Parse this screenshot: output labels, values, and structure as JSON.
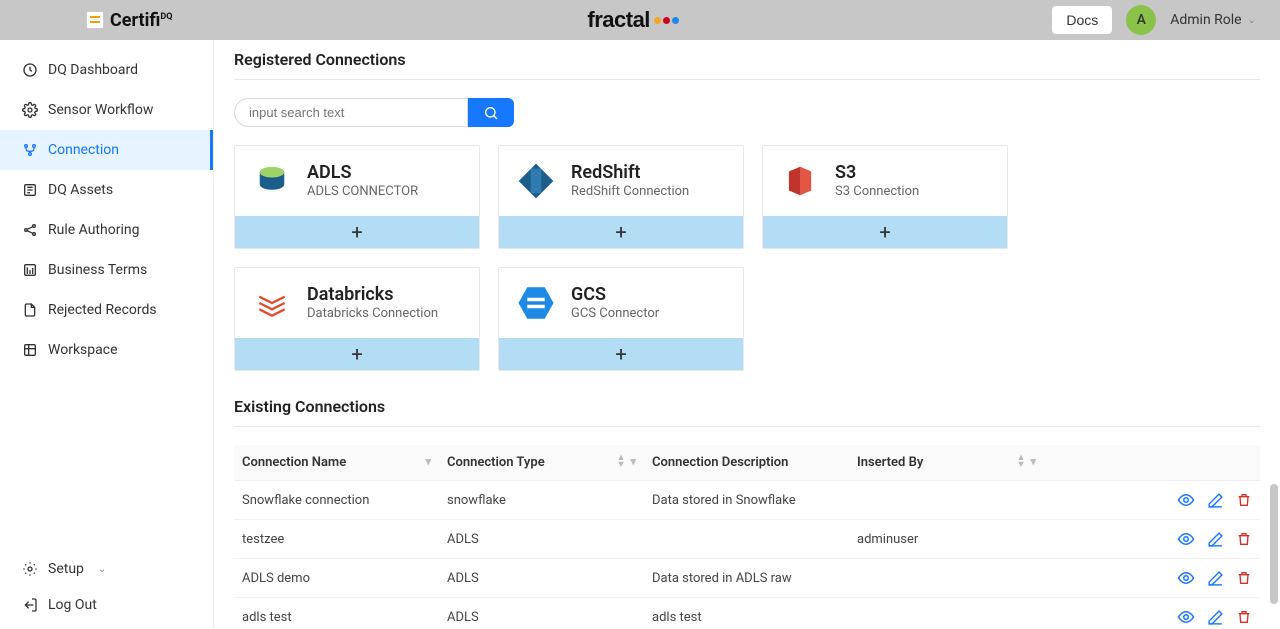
{
  "header": {
    "brand": "Certifi",
    "brand_suffix": "DQ",
    "center_brand": "fractal",
    "docs_label": "Docs",
    "avatar_initial": "A",
    "role_label": "Admin Role"
  },
  "sidebar": {
    "items": [
      {
        "label": "DQ Dashboard",
        "icon": "dashboard"
      },
      {
        "label": "Sensor Workflow",
        "icon": "gear"
      },
      {
        "label": "Connection",
        "icon": "branch",
        "active": true
      },
      {
        "label": "DQ Assets",
        "icon": "assets"
      },
      {
        "label": "Rule Authoring",
        "icon": "share"
      },
      {
        "label": "Business Terms",
        "icon": "terms"
      },
      {
        "label": "Rejected Records",
        "icon": "file"
      },
      {
        "label": "Workspace",
        "icon": "workspace"
      }
    ],
    "bottom": [
      {
        "label": "Setup",
        "icon": "gear",
        "caret": true
      },
      {
        "label": "Log Out",
        "icon": "logout"
      }
    ]
  },
  "connections": {
    "section_title": "Registered Connections",
    "search_placeholder": "input search text",
    "cards": [
      {
        "title": "ADLS",
        "subtitle": "ADLS CONNECTOR",
        "color1": "#7ac142",
        "color2": "#1b5e8c"
      },
      {
        "title": "RedShift",
        "subtitle": "RedShift Connection",
        "color1": "#1b5e8c",
        "color2": "#1b5e8c"
      },
      {
        "title": "S3",
        "subtitle": "S3 Connection",
        "color1": "#c1342b",
        "color2": "#c1342b"
      },
      {
        "title": "Databricks",
        "subtitle": "Databricks Connection",
        "color1": "#e04e2f",
        "color2": "#e04e2f"
      },
      {
        "title": "GCS",
        "subtitle": "GCS Connector",
        "color1": "#1e88e5",
        "color2": "#1e88e5"
      }
    ]
  },
  "existing": {
    "section_title": "Existing Connections",
    "columns": {
      "name": "Connection Name",
      "type": "Connection Type",
      "desc": "Connection Description",
      "by": "Inserted By"
    },
    "rows": [
      {
        "name": "Snowflake connection",
        "type": "snowflake",
        "desc": "Data stored in Snowflake",
        "by": ""
      },
      {
        "name": "testzee",
        "type": "ADLS",
        "desc": "",
        "by": "adminuser"
      },
      {
        "name": "ADLS demo",
        "type": "ADLS",
        "desc": "Data stored in ADLS raw",
        "by": ""
      },
      {
        "name": "adls test",
        "type": "ADLS",
        "desc": "adls test",
        "by": ""
      }
    ]
  }
}
